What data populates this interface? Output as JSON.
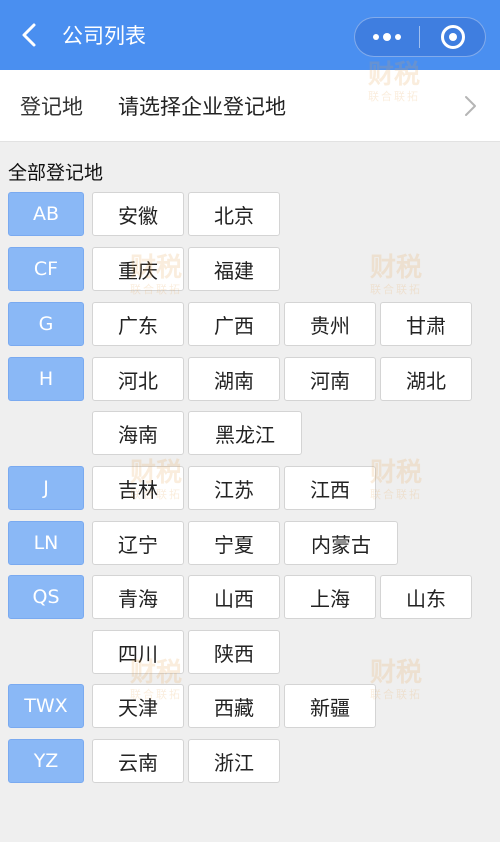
{
  "nav": {
    "title": "公司列表",
    "back_icon": "chevron-left-icon",
    "more_icon": "more-icon",
    "close_icon": "target-icon",
    "bg_color": "#4a8ff0"
  },
  "register": {
    "label": "登记地",
    "placeholder": "请选择企业登记地",
    "arrow_icon": "chevron-right-icon"
  },
  "section_title": "全部登记地",
  "groups": [
    {
      "letter": "AB",
      "cities": [
        "安徽",
        "北京"
      ]
    },
    {
      "letter": "CF",
      "cities": [
        "重庆",
        "福建"
      ]
    },
    {
      "letter": "G",
      "cities": [
        "广东",
        "广西",
        "贵州",
        "甘肃"
      ]
    },
    {
      "letter": "H",
      "cities": [
        "河北",
        "湖南",
        "河南",
        "湖北",
        "海南",
        "黑龙江"
      ]
    },
    {
      "letter": "J",
      "cities": [
        "吉林",
        "江苏",
        "江西"
      ]
    },
    {
      "letter": "LN",
      "cities": [
        "辽宁",
        "宁夏",
        "内蒙古"
      ]
    },
    {
      "letter": "QS",
      "cities": [
        "青海",
        "山西",
        "上海",
        "山东",
        "四川",
        "陕西"
      ]
    },
    {
      "letter": "TWX",
      "cities": [
        "天津",
        "西藏",
        "新疆"
      ]
    },
    {
      "letter": "YZ",
      "cities": [
        "云南",
        "浙江"
      ]
    }
  ],
  "watermark": {
    "brand": "财税",
    "sub": "联合联拓"
  },
  "colors": {
    "letter_bg": "#8ab8f6",
    "city_bg": "#ffffff",
    "page_bg": "#efefef"
  }
}
